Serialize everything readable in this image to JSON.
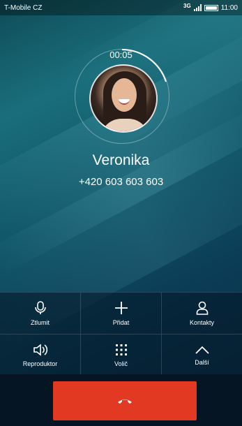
{
  "status_bar": {
    "carrier": "T-Mobile CZ",
    "network": "3G",
    "time": "11:00"
  },
  "call": {
    "timer": "00:05",
    "name": "Veronika",
    "number": "+420 603 603 603"
  },
  "actions": {
    "mute": {
      "label": "Ztlumit",
      "icon": "microphone-icon"
    },
    "add": {
      "label": "Přidat",
      "icon": "plus-icon"
    },
    "contacts": {
      "label": "Kontakty",
      "icon": "person-icon"
    },
    "speaker": {
      "label": "Reproduktor",
      "icon": "speaker-icon"
    },
    "keypad": {
      "label": "Volič",
      "icon": "dialpad-icon"
    },
    "more": {
      "label": "Další",
      "icon": "chevron-up-icon"
    }
  },
  "colors": {
    "end_call": "#e23a22"
  }
}
